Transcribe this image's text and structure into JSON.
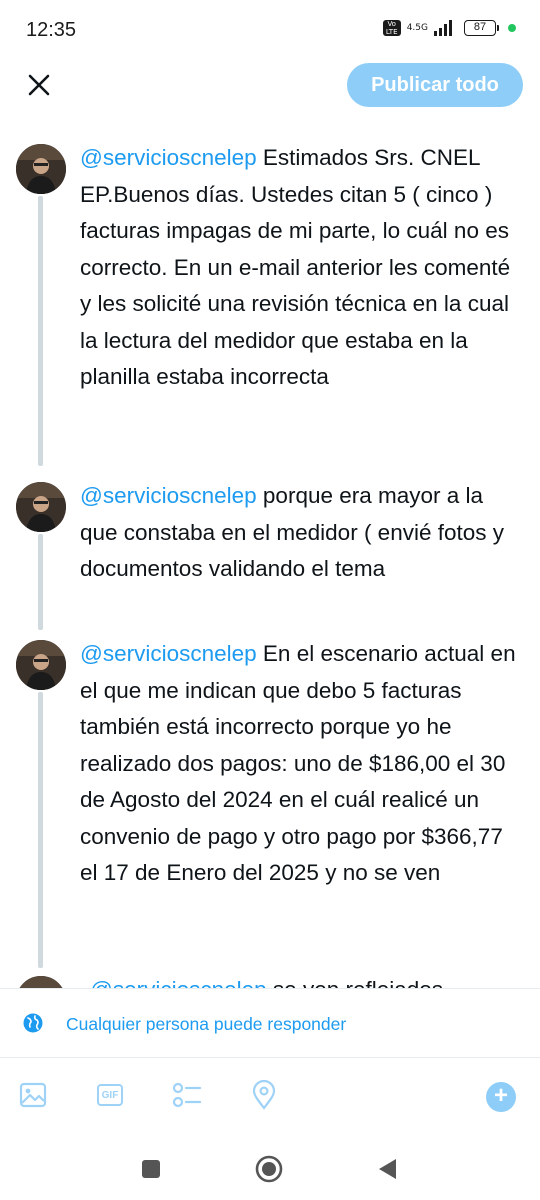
{
  "status_bar": {
    "time": "12:35",
    "network_badge": "Vo LTE",
    "network_type": "4.5G",
    "battery_level": "87"
  },
  "header": {
    "close_icon": "close-icon",
    "publish_label": "Publicar todo",
    "publish_color": "#8ecdf7"
  },
  "thread": {
    "tweets": [
      {
        "mention": "@servicioscnelep",
        "text": " Estimados Srs. CNEL EP.Buenos días. Ustedes citan 5 ( cinco ) facturas impagas de mi parte, lo cuál no es correcto. En un e-mail anterior les comenté y les solicité una revisión técnica en la cual la lectura del medidor que estaba en la planilla estaba incorrecta"
      },
      {
        "mention": "@servicioscnelep",
        "text": " porque era mayor a la que constaba en el medidor ( envié fotos y documentos validando el tema"
      },
      {
        "mention": "@servicioscnelep",
        "text": " En el escenario actual en el que me indican que debo 5 facturas también está incorrecto porque yo he realizado dos pagos: uno de $186,00 el 30 de Agosto del 2024 en el cuál realicé un convenio de pago y otro pago por $366,77 el 17 de Enero del 2025 y no se ven"
      },
      {
        "mention": "@servicioscnelep",
        "text": " se ven reflejados"
      }
    ]
  },
  "reply_setting": {
    "icon": "globe-icon",
    "label": "Cualquier persona puede responder"
  },
  "toolbar": {
    "items": [
      "image-icon",
      "gif-icon",
      "poll-icon",
      "location-icon"
    ],
    "gif_label": "GIF",
    "add_label": "+",
    "accent": "#1d9bf0"
  },
  "navbar": {
    "items": [
      "recents-icon",
      "home-icon",
      "back-icon"
    ]
  }
}
